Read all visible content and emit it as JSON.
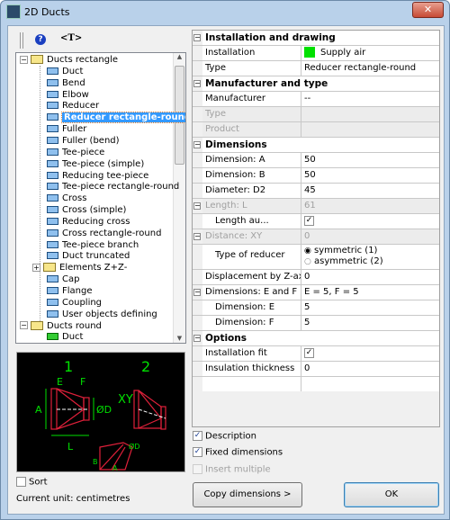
{
  "window": {
    "title": "2D Ducts",
    "close_icon": "close-icon"
  },
  "toolbar": {
    "help_label": "?",
    "text_label": "<T>"
  },
  "tree": [
    {
      "label": "Ducts rectangle",
      "type": "folder",
      "level": 0,
      "expanded": true
    },
    {
      "label": "Duct",
      "level": 1
    },
    {
      "label": "Bend",
      "level": 1
    },
    {
      "label": "Elbow",
      "level": 1
    },
    {
      "label": "Reducer",
      "level": 1
    },
    {
      "label": "Reducer rectangle-round",
      "level": 1,
      "selected": true
    },
    {
      "label": "Fuller",
      "level": 1
    },
    {
      "label": "Fuller (bend)",
      "level": 1
    },
    {
      "label": "Tee-piece",
      "level": 1
    },
    {
      "label": "Tee-piece (simple)",
      "level": 1
    },
    {
      "label": "Reducing tee-piece",
      "level": 1
    },
    {
      "label": "Tee-piece rectangle-round",
      "level": 1
    },
    {
      "label": "Cross",
      "level": 1
    },
    {
      "label": "Cross (simple)",
      "level": 1
    },
    {
      "label": "Reducing cross",
      "level": 1
    },
    {
      "label": "Cross rectangle-round",
      "level": 1
    },
    {
      "label": "Tee-piece branch",
      "level": 1
    },
    {
      "label": "Duct truncated",
      "level": 1
    },
    {
      "label": "Elements Z+Z-",
      "type": "folder",
      "level": 1,
      "expanded": false
    },
    {
      "label": "Cap",
      "level": 1
    },
    {
      "label": "Flange",
      "level": 1
    },
    {
      "label": "Coupling",
      "level": 1
    },
    {
      "label": "User objects defining",
      "level": 1
    },
    {
      "label": "Ducts round",
      "type": "folder",
      "level": 0,
      "expanded": true
    },
    {
      "label": "Duct",
      "level": 1,
      "green": true
    }
  ],
  "preview": {
    "label1": "1",
    "label2": "2",
    "dims": [
      "E",
      "F",
      "A",
      "ØD",
      "L",
      "XY",
      "B",
      "A",
      "ØD"
    ]
  },
  "sort_label": "Sort",
  "unit_text": "Current unit: centimetres",
  "grid": {
    "installation_drawing": "Installation and drawing",
    "installation_label": "Installation",
    "installation_value": "Supply air",
    "installation_color": "#00e000",
    "type_label": "Type",
    "type_value": "Reducer rectangle-round",
    "manufacturer_type": "Manufacturer and type",
    "manufacturer_label": "Manufacturer",
    "manufacturer_value": "--",
    "type2_label": "Type",
    "product_label": "Product",
    "dimensions": "Dimensions",
    "dim_a_label": "Dimension: A",
    "dim_a": "50",
    "dim_b_label": "Dimension: B",
    "dim_b": "50",
    "d2_label": "Diameter: D2",
    "d2": "45",
    "length_label": "Length: L",
    "length": "61",
    "length_auto_label": "Length au...",
    "length_auto": true,
    "distance_label": "Distance: XY",
    "distance": "0",
    "reducer_label": "Type of reducer",
    "reducer_opt1": "symmetric (1)",
    "reducer_opt2": "asymmetric (2)",
    "displacement_label": "Displacement by Z-axis:",
    "displacement": "0",
    "ef_label": "Dimensions: E and F",
    "ef": "E = 5,  F = 5",
    "e_label": "Dimension: E",
    "e": "5",
    "f_label": "Dimension: F",
    "f": "5",
    "options": "Options",
    "fit_label": "Installation fit",
    "fit": true,
    "insulation_label": "Insulation thickness",
    "insulation": "0"
  },
  "checks": {
    "description": "Description",
    "fixed": "Fixed dimensions",
    "multiple": "Insert multiple"
  },
  "buttons": {
    "copy": "Copy dimensions  >",
    "ok": "OK"
  }
}
